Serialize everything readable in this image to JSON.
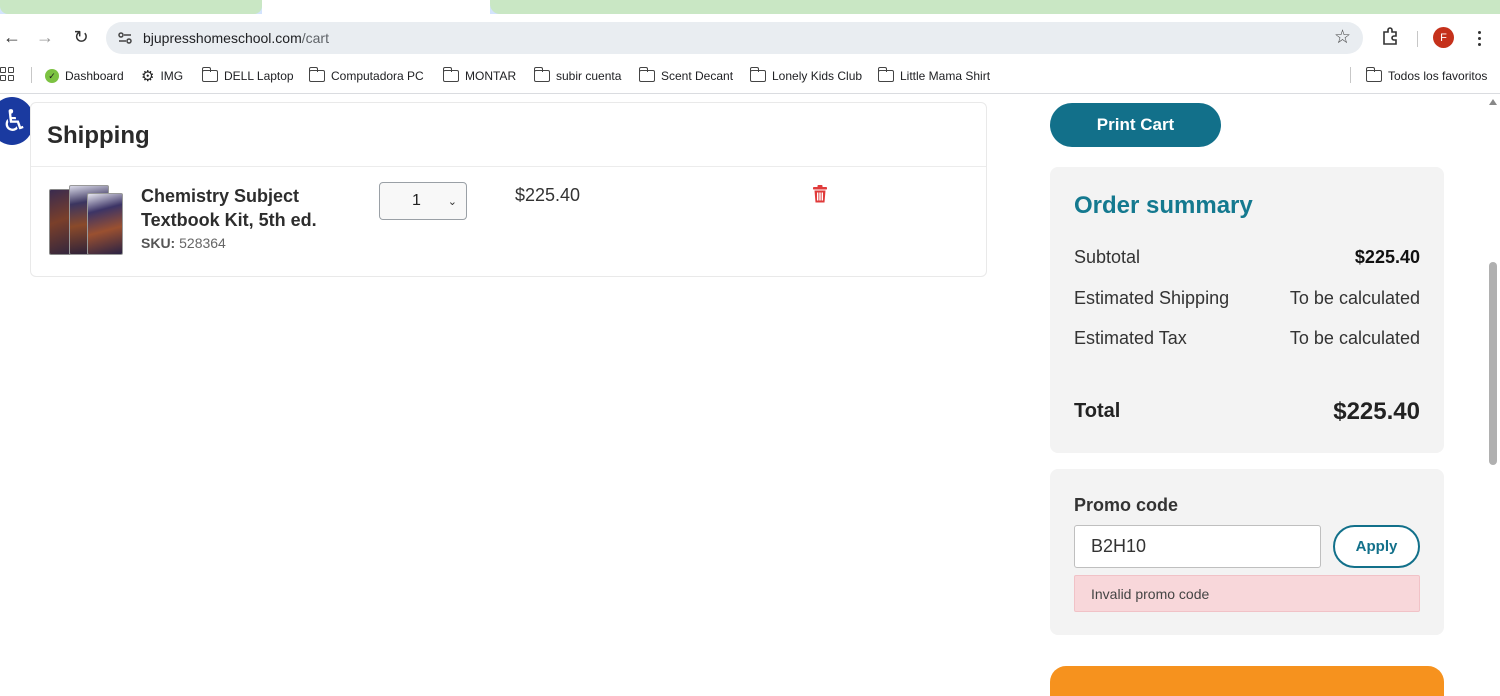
{
  "browser": {
    "url_host": "bjupresshomeschool.com",
    "url_path": "/cart",
    "profile_initial": "F",
    "bookmarks": [
      {
        "label": "Dashboard",
        "icon": "dashboard-icon"
      },
      {
        "label": "IMG",
        "icon": "gear-icon"
      },
      {
        "label": "DELL Laptop",
        "icon": "folder-icon"
      },
      {
        "label": "Computadora PC",
        "icon": "folder-icon"
      },
      {
        "label": "MONTAR",
        "icon": "folder-icon"
      },
      {
        "label": "subir cuenta",
        "icon": "folder-icon"
      },
      {
        "label": "Scent Decant",
        "icon": "folder-icon"
      },
      {
        "label": "Lonely Kids Club",
        "icon": "folder-icon"
      },
      {
        "label": "Little Mama Shirt",
        "icon": "folder-icon"
      }
    ],
    "all_bookmarks": "Todos los favoritos"
  },
  "cart": {
    "title": "Shipping",
    "item": {
      "name": "Chemistry Subject Textbook Kit, 5th ed.",
      "sku_label": "SKU:",
      "sku": "528364",
      "quantity": "1",
      "price": "$225.40"
    }
  },
  "print_cart": "Print Cart",
  "summary": {
    "title": "Order summary",
    "subtotal_label": "Subtotal",
    "subtotal": "$225.40",
    "shipping_label": "Estimated Shipping",
    "shipping": "To be calculated",
    "tax_label": "Estimated Tax",
    "tax": "To be calculated",
    "total_label": "Total",
    "total": "$225.40"
  },
  "promo": {
    "label": "Promo code",
    "value": "B2H10",
    "apply": "Apply",
    "error": "Invalid promo code"
  },
  "colors": {
    "accent": "#12708a",
    "error_bg": "#f8d7da",
    "checkout": "#f6921e",
    "delete": "#e03b3b"
  }
}
